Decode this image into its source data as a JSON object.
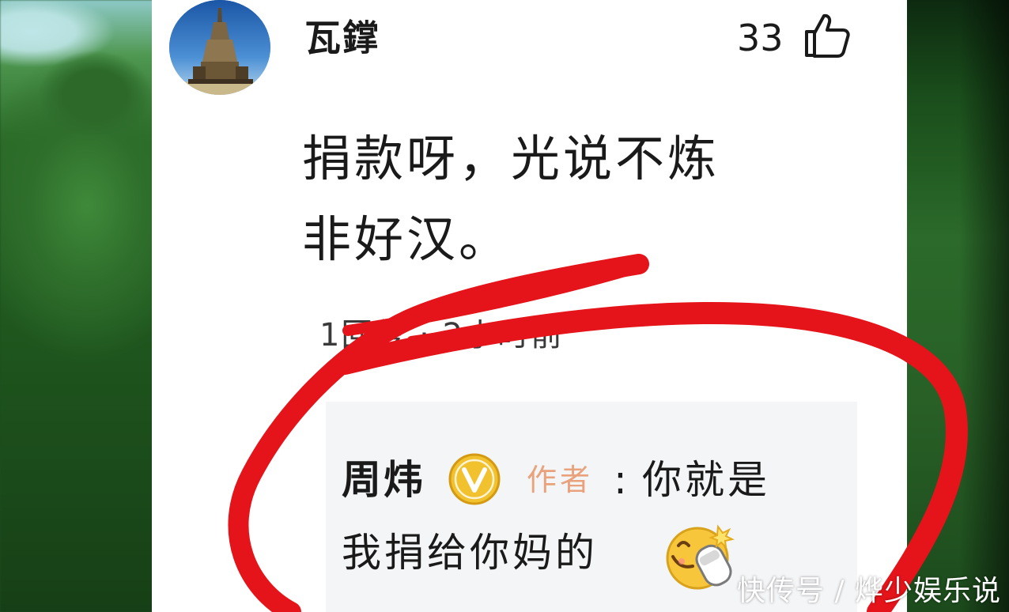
{
  "comment": {
    "username": "瓦鐣",
    "like_count": "33",
    "text_line1": "捐款呀，光说不炼",
    "text_line2": "非好汉。",
    "meta": "1回复 · 2小时前"
  },
  "reply": {
    "author": "周炜",
    "author_tag": "作者",
    "colon": ":",
    "text_line1": "你就是",
    "text_line2": "我捐给你妈的"
  },
  "icons": {
    "like": "thumbs-up-icon",
    "verified": "verified-v-badge-icon",
    "emoji": "laughing-slipper-emoji-icon"
  },
  "colors": {
    "author_tag": "#e9a27c",
    "verified_badge": "#f2c12e",
    "annotation_red": "#e4141a"
  },
  "watermark": {
    "text": "快传号 / 烨少娱乐说"
  }
}
